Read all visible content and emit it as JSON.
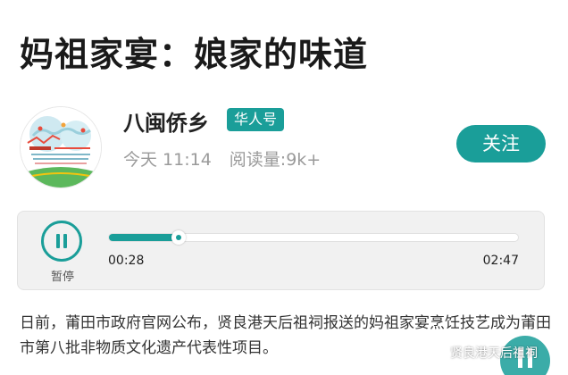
{
  "article": {
    "title": "妈祖家宴：娘家的味道",
    "body": "日前，莆田市政府官网公布，贤良港天后祖祠报送的妈祖家宴烹饪技艺成为莆田市第八批非物质文化遗产代表性项目。"
  },
  "author": {
    "name": "八闽侨乡",
    "badge": "华人号",
    "time": "今天 11:14",
    "reads": "阅读量:9k+",
    "follow_label": "关注",
    "avatar_icon": "channel-logo"
  },
  "player": {
    "state_label": "暂停",
    "current_time": "00:28",
    "total_time": "02:47",
    "progress": 0.17
  },
  "watermark": {
    "text": "贤良港天后祖祠",
    "icon": "wechat-icon"
  },
  "colors": {
    "accent": "#1a9e99",
    "title": "#1a1a1a",
    "meta": "#9a9a9a",
    "player_bg": "#f1f1f1"
  }
}
